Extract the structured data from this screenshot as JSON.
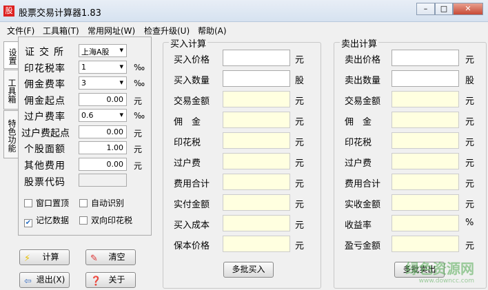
{
  "window": {
    "title": "股票交易计算器1.83",
    "minimize": "–",
    "maximize": "□",
    "close": "✕"
  },
  "menu": [
    "文件(F)",
    "工具箱(T)",
    "常用网址(W)",
    "检查升级(U)",
    "帮助(A)"
  ],
  "vtabs": [
    "设置",
    "工具箱",
    "特色功能"
  ],
  "settings": {
    "exchange": {
      "label": "证交所",
      "value": "上海A股"
    },
    "stamp_rate": {
      "label": "印花税率",
      "value": "1",
      "unit": "‰"
    },
    "commission_rate": {
      "label": "佣金费率",
      "value": "3",
      "unit": "‰"
    },
    "commission_min": {
      "label": "佣金起点",
      "value": "0.00",
      "unit": "元"
    },
    "transfer_rate": {
      "label": "过户费率",
      "value": "0.6",
      "unit": "‰"
    },
    "transfer_min": {
      "label": "过户费起点",
      "value": "0.00",
      "unit": "元"
    },
    "par_value": {
      "label": "个股面额",
      "value": "1.00",
      "unit": "元"
    },
    "other_fee": {
      "label": "其他费用",
      "value": "0.00",
      "unit": "元"
    },
    "stock_code": {
      "label": "股票代码",
      "value": ""
    },
    "checkboxes": [
      {
        "label": "窗口置顶",
        "checked": false
      },
      {
        "label": "自动识别",
        "checked": false
      },
      {
        "label": "记忆数据",
        "checked": true
      },
      {
        "label": "双向印花税",
        "checked": false
      }
    ]
  },
  "buttons": {
    "calc": "计算",
    "clear": "清空",
    "exit": "退出(X)",
    "about": "关于"
  },
  "buy": {
    "title": "买入计算",
    "rows": [
      {
        "label": "买入价格",
        "unit": "元",
        "editable": true
      },
      {
        "label": "买入数量",
        "unit": "股",
        "editable": true
      },
      {
        "label": "交易金额",
        "unit": "元"
      },
      {
        "label": "佣　金",
        "unit": "元"
      },
      {
        "label": "印花税",
        "unit": "元"
      },
      {
        "label": "过户费",
        "unit": "元"
      },
      {
        "label": "费用合计",
        "unit": "元"
      },
      {
        "label": "实付金额",
        "unit": "元"
      },
      {
        "label": "买入成本",
        "unit": "元"
      },
      {
        "label": "保本价格",
        "unit": "元"
      }
    ],
    "button": "多批买入"
  },
  "sell": {
    "title": "卖出计算",
    "rows": [
      {
        "label": "卖出价格",
        "unit": "元",
        "editable": true
      },
      {
        "label": "卖出数量",
        "unit": "股",
        "editable": true
      },
      {
        "label": "交易金额",
        "unit": "元"
      },
      {
        "label": "佣　金",
        "unit": "元"
      },
      {
        "label": "印花税",
        "unit": "元"
      },
      {
        "label": "过户费",
        "unit": "元"
      },
      {
        "label": "费用合计",
        "unit": "元"
      },
      {
        "label": "实收金额",
        "unit": "元"
      },
      {
        "label": "收益率",
        "unit": "%"
      },
      {
        "label": "盈亏金额",
        "unit": "元"
      }
    ],
    "button": "多批卖出"
  },
  "watermark": {
    "name": "绿色资源网",
    "url": "www.downcc.com"
  }
}
